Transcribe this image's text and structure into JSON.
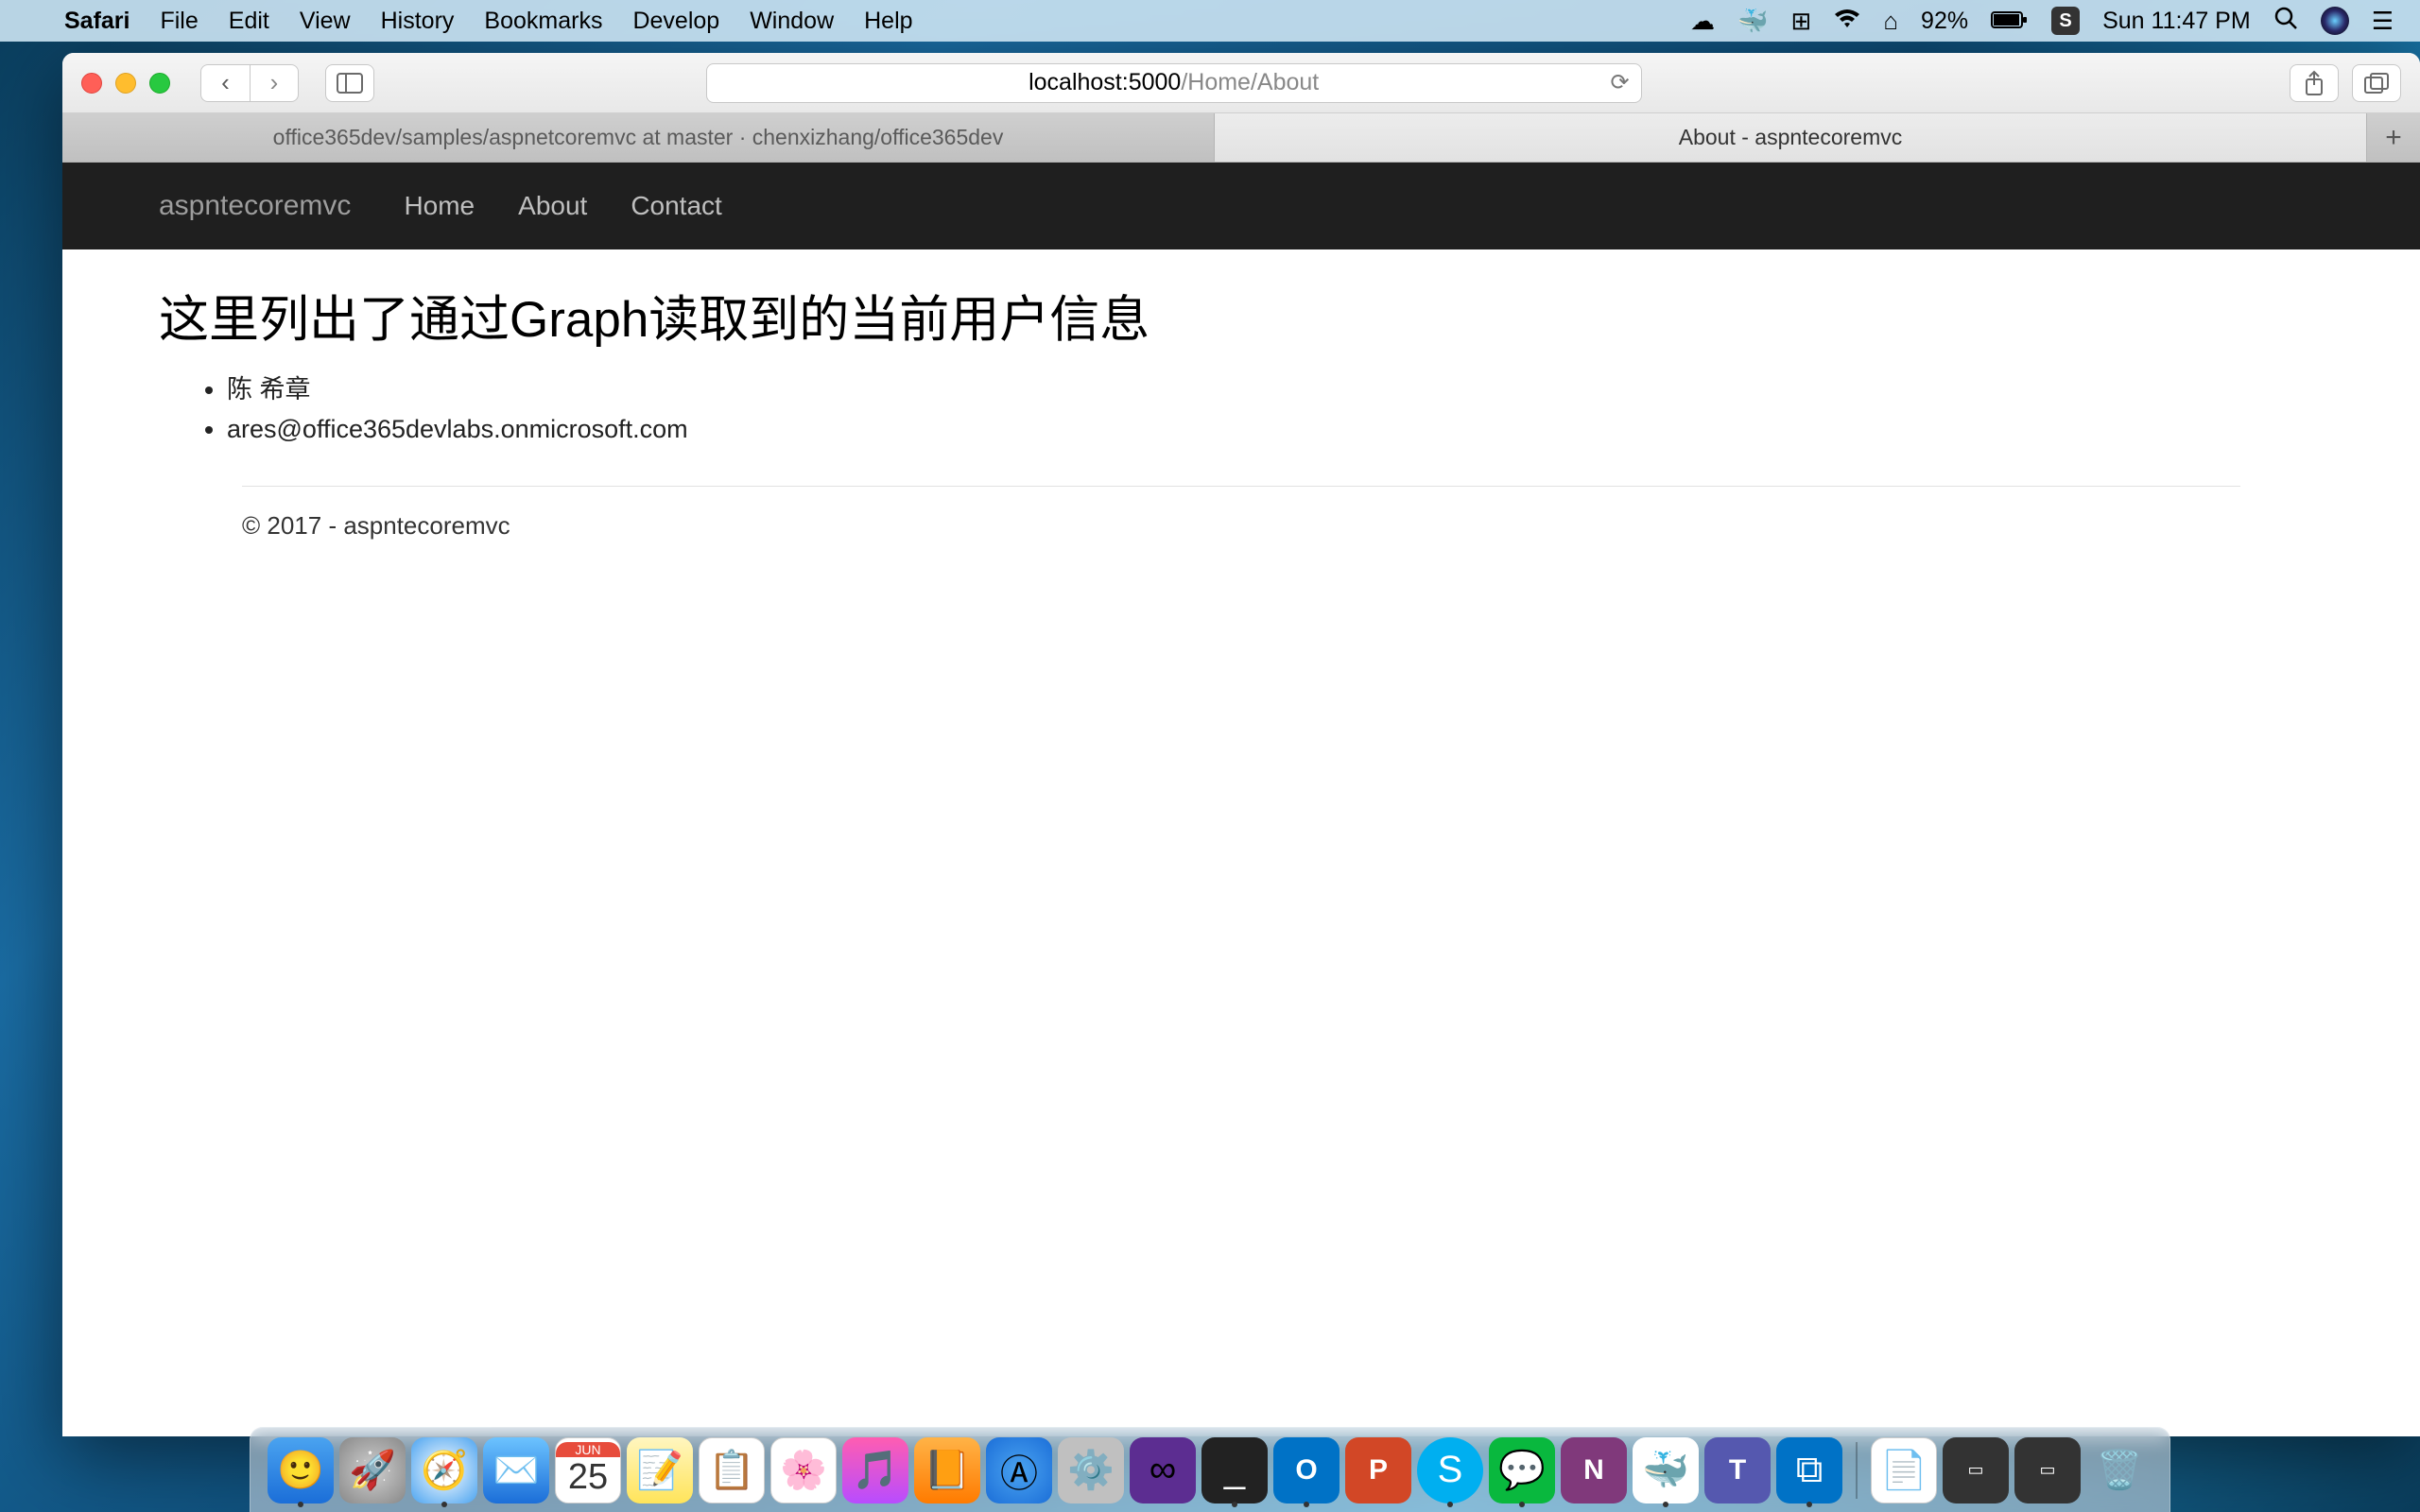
{
  "menubar": {
    "app_name": "Safari",
    "items": [
      "File",
      "Edit",
      "View",
      "History",
      "Bookmarks",
      "Develop",
      "Window",
      "Help"
    ],
    "battery_pct": "92%",
    "clock": "Sun 11:47 PM"
  },
  "browser": {
    "url_host": "localhost:5000",
    "url_path": "/Home/About",
    "tabs": [
      {
        "title": "office365dev/samples/aspnetcoremvc at master · chenxizhang/office365dev",
        "active": false
      },
      {
        "title": "About - aspntecoremvc",
        "active": true
      }
    ]
  },
  "site": {
    "brand": "aspntecoremvc",
    "nav": [
      "Home",
      "About",
      "Contact"
    ]
  },
  "page": {
    "heading": "这里列出了通过Graph读取到的当前用户信息",
    "items": [
      "陈 希章",
      "ares@office365devlabs.onmicrosoft.com"
    ],
    "footer": "© 2017 - aspntecoremvc"
  },
  "dock": {
    "cal_month": "JUN",
    "cal_day": "25"
  }
}
